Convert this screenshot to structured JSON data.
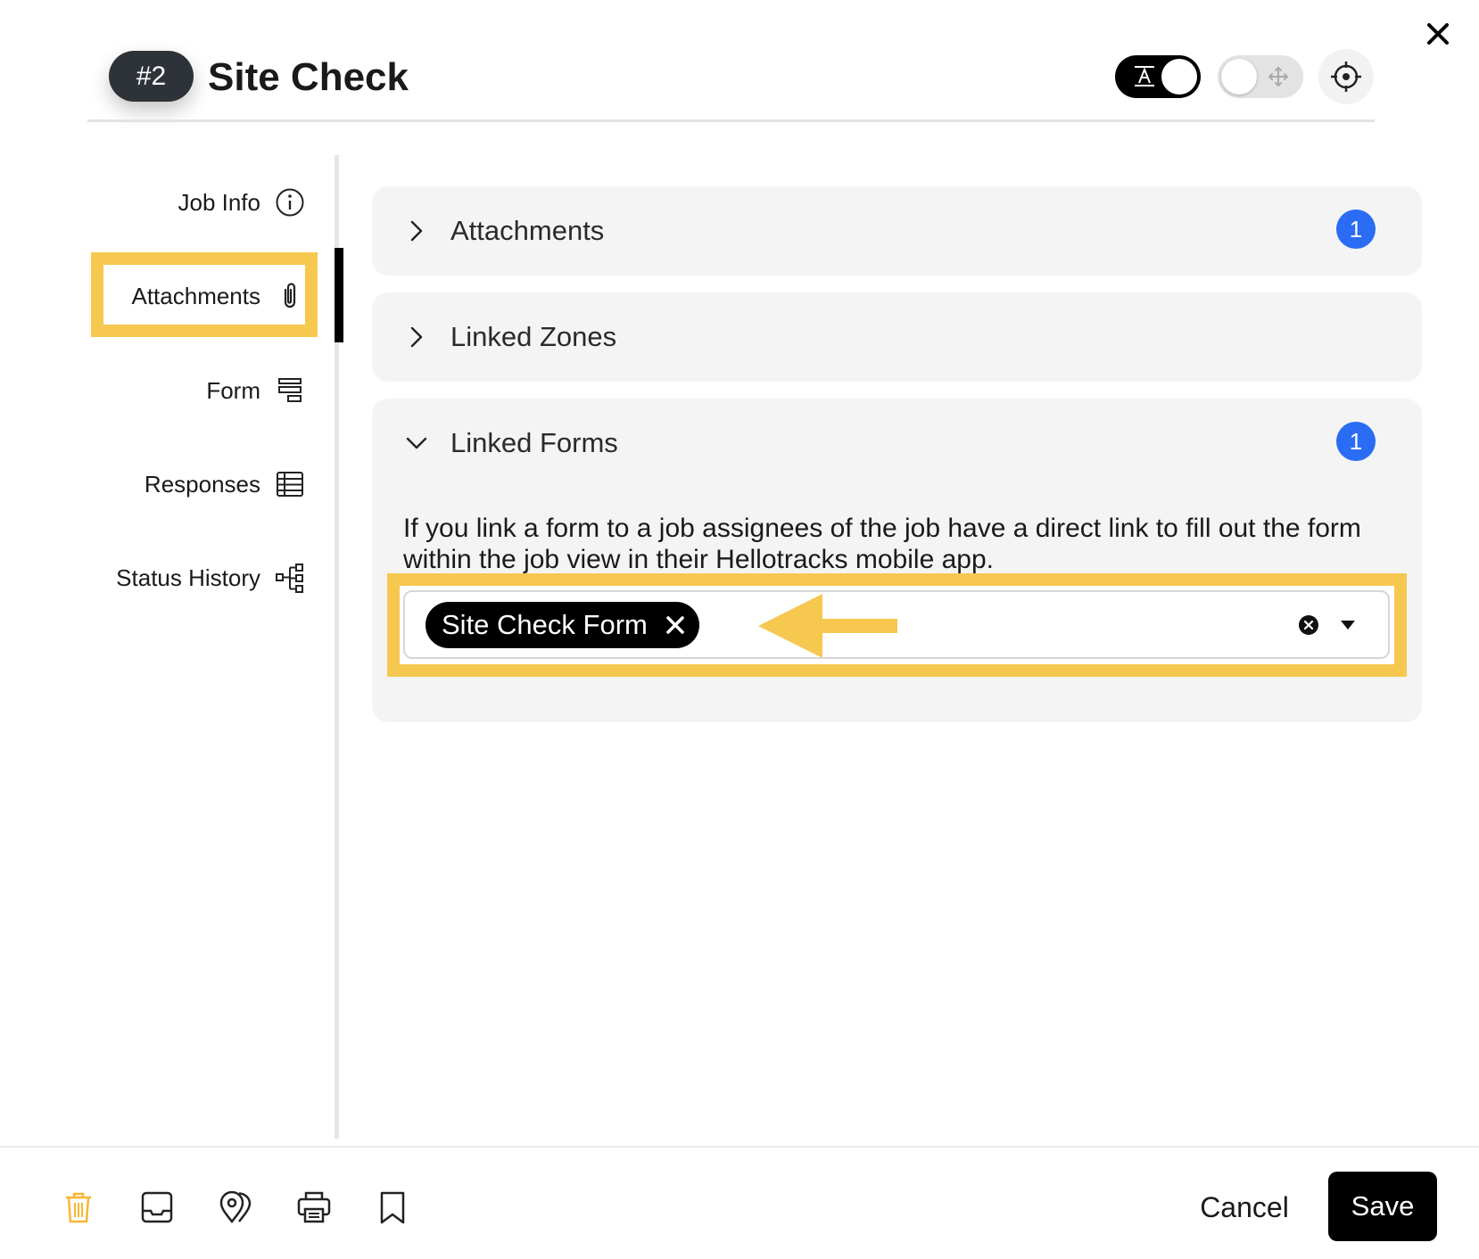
{
  "header": {
    "job_number": "#2",
    "title": "Site Check",
    "toggle_text_icon": "text-format-icon",
    "toggle_move_icon": "move-icon",
    "target_icon": "crosshair-icon",
    "close_icon": "close-icon"
  },
  "sidebar": {
    "items": [
      {
        "label": "Job Info",
        "icon": "info-icon"
      },
      {
        "label": "Attachments",
        "icon": "paperclip-icon"
      },
      {
        "label": "Form",
        "icon": "form-icon"
      },
      {
        "label": "Responses",
        "icon": "table-icon"
      },
      {
        "label": "Status History",
        "icon": "hierarchy-icon"
      }
    ],
    "active": "Attachments"
  },
  "sections": [
    {
      "title": "Attachments",
      "count": "1",
      "expanded": false
    },
    {
      "title": "Linked Zones",
      "expanded": false
    },
    {
      "title": "Linked Forms",
      "count": "1",
      "expanded": true,
      "description": "If you link a form to a job assignees of the job have a direct link to fill out the form within the job view in their Hellotracks mobile app.",
      "selected": [
        {
          "label": "Site Check Form"
        }
      ]
    }
  ],
  "footer": {
    "icons": [
      "trash-icon",
      "inbox-icon",
      "map-pins-icon",
      "printer-icon",
      "bookmark-icon"
    ],
    "cancel_label": "Cancel",
    "save_label": "Save"
  },
  "colors": {
    "highlight": "#f7c850",
    "badge_blue": "#2a6df4",
    "trash_orange": "#f7b733"
  }
}
